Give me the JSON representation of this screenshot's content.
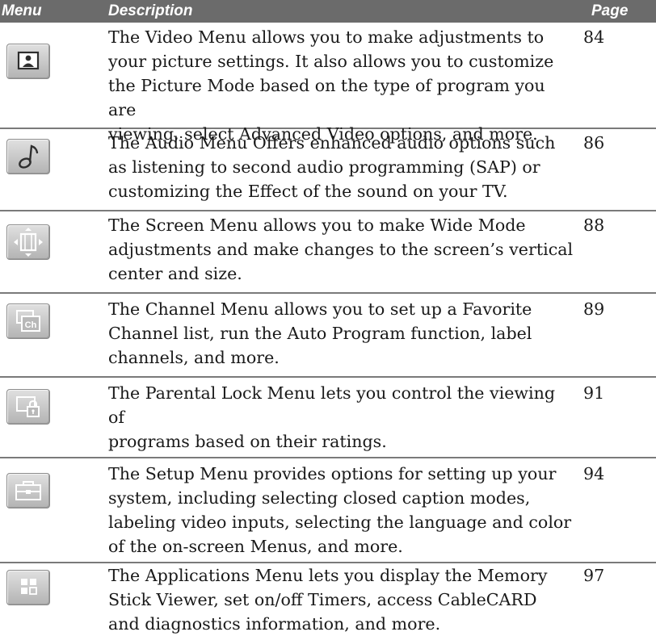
{
  "header": {
    "menu": "Menu",
    "description": "Description",
    "page": "Page"
  },
  "rows": [
    {
      "icon": "video-picture-icon",
      "description": "The Video Menu allows you to make adjustments to\nyour picture settings. It also allows you to customize\nthe Picture Mode based on the type of program you are\nviewing, select Advanced Video options, and more.",
      "page": "84"
    },
    {
      "icon": "audio-note-icon",
      "description": "The Audio Menu Offers enhanced audio options such\nas listening to second audio programming (SAP) or\ncustomizing the Effect of the sound on your TV.",
      "page": "86"
    },
    {
      "icon": "screen-resize-icon",
      "description": "The Screen Menu allows you to make Wide Mode\nadjustments and make changes to the screen’s vertical\ncenter and size.",
      "page": "88"
    },
    {
      "icon": "channel-icon",
      "icon_text": "Ch",
      "description": "The Channel Menu allows you to set up a Favorite\nChannel list, run the Auto Program function, label\nchannels, and more.",
      "page": "89"
    },
    {
      "icon": "parental-lock-icon",
      "description": "The Parental Lock Menu lets you control the viewing of\nprograms based on their ratings.",
      "page": "91"
    },
    {
      "icon": "setup-toolbox-icon",
      "description": "The Setup Menu provides options for  setting up your\nsystem, including selecting closed caption modes,\nlabeling video inputs, selecting the language and color\nof the on-screen Menus, and more.",
      "page": "94"
    },
    {
      "icon": "applications-grid-icon",
      "description": "The Applications Menu lets you display the Memory\nStick Viewer, set on/off Timers, access CableCARD\nand diagnostics information, and more.",
      "page": "97"
    }
  ]
}
